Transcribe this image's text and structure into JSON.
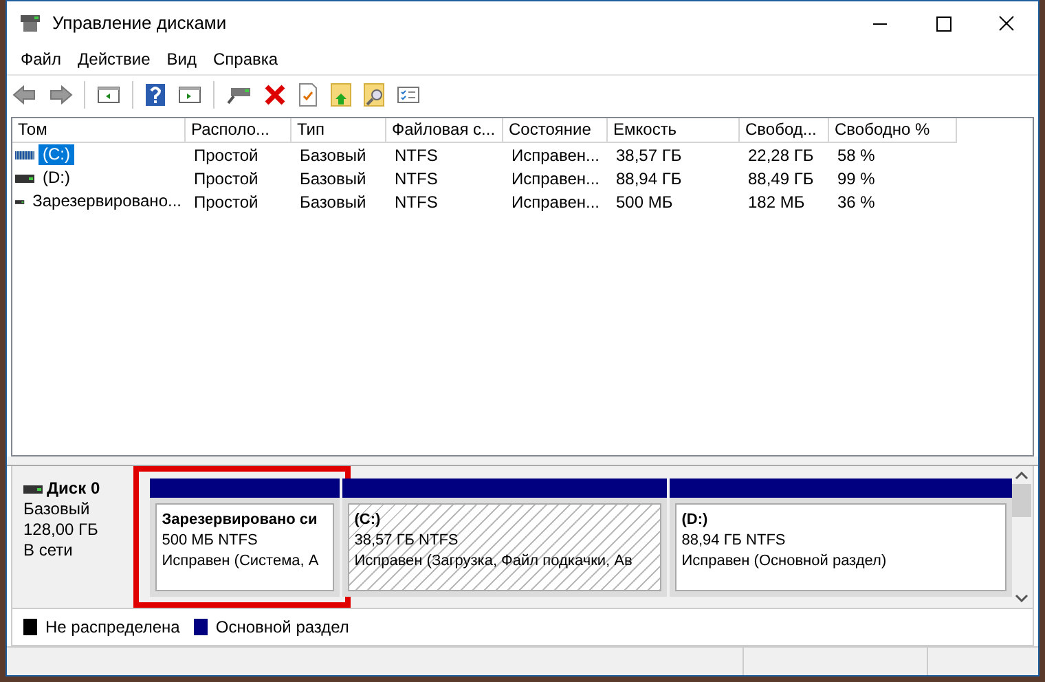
{
  "window": {
    "title": "Управление дисками"
  },
  "menu": [
    "Файл",
    "Действие",
    "Вид",
    "Справка"
  ],
  "table": {
    "columns": [
      "Том",
      "Располо...",
      "Тип",
      "Файловая с...",
      "Состояние",
      "Емкость",
      "Свобод...",
      "Свободно %"
    ],
    "rows": [
      {
        "selected": true,
        "kind": "striped",
        "cells": [
          "(C:)",
          "Простой",
          "Базовый",
          "NTFS",
          "Исправен...",
          "38,57 ГБ",
          "22,28 ГБ",
          "58 %"
        ]
      },
      {
        "selected": false,
        "kind": "plain",
        "cells": [
          "(D:)",
          "Простой",
          "Базовый",
          "NTFS",
          "Исправен...",
          "88,94 ГБ",
          "88,49 ГБ",
          "99 %"
        ]
      },
      {
        "selected": false,
        "kind": "plain",
        "cells": [
          "Зарезервировано...",
          "Простой",
          "Базовый",
          "NTFS",
          "Исправен...",
          "500 МБ",
          "182 МБ",
          "36 %"
        ]
      }
    ]
  },
  "disk": {
    "name": "Диск 0",
    "type": "Базовый",
    "size": "128,00 ГБ",
    "status": "В сети",
    "partitions": [
      {
        "name": "Зарезервировано си",
        "size": "500 МБ NTFS",
        "status": "Исправен (Система, А",
        "selected": false,
        "highlighted": true
      },
      {
        "name": "(C:)",
        "size": "38,57 ГБ NTFS",
        "status": "Исправен (Загрузка, Файл подкачки, Ав",
        "selected": true,
        "highlighted": false
      },
      {
        "name": "(D:)",
        "size": "88,94 ГБ NTFS",
        "status": "Исправен (Основной раздел)",
        "selected": false,
        "highlighted": false
      }
    ]
  },
  "legend": [
    {
      "label": "Не распределена",
      "color": "#000000"
    },
    {
      "label": "Основной раздел",
      "color": "#000080"
    }
  ]
}
